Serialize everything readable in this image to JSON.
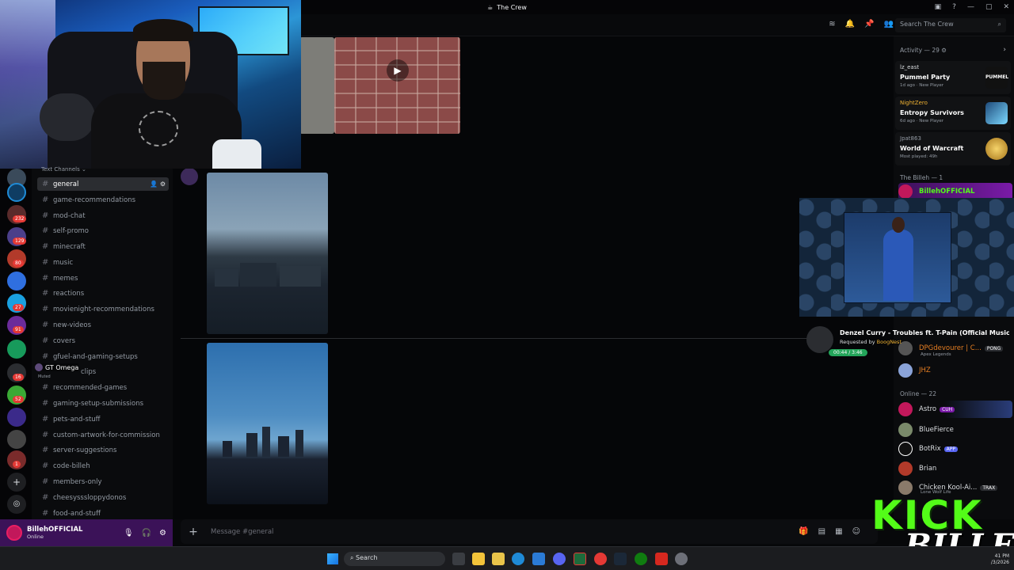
{
  "window": {
    "title": "The Crew",
    "search_placeholder": "Search The Crew"
  },
  "channels": {
    "header": "Text Channels",
    "items": [
      {
        "label": "general",
        "active": true
      },
      {
        "label": "game-recommendations"
      },
      {
        "label": "mod-chat"
      },
      {
        "label": "self-promo"
      },
      {
        "label": "minecraft"
      },
      {
        "label": "music"
      },
      {
        "label": "memes"
      },
      {
        "label": "reactions"
      },
      {
        "label": "movienight-recommendations"
      },
      {
        "label": "new-videos"
      },
      {
        "label": "covers"
      },
      {
        "label": "gfuel-and-gaming-setups"
      },
      {
        "label": "clips"
      },
      {
        "label": "recommended-games"
      },
      {
        "label": "gaming-setup-submissions"
      },
      {
        "label": "pets-and-stuff"
      },
      {
        "label": "custom-artwork-for-commission"
      },
      {
        "label": "server-suggestions"
      },
      {
        "label": "code-billeh"
      },
      {
        "label": "members-only"
      },
      {
        "label": "cheesysssloppydonos"
      },
      {
        "label": "food-and-stuff"
      }
    ]
  },
  "server_badges": [
    "232",
    "129",
    "80",
    "27",
    "91",
    "16",
    "52",
    "1"
  ],
  "overlay_user": {
    "name": "GT Omega",
    "sub": "Muted"
  },
  "user_panel": {
    "name": "BillehOFFICIAL",
    "status": "Online"
  },
  "composer": {
    "placeholder": "Message #general"
  },
  "members": {
    "activity_header": "Activity — 29",
    "activities": [
      {
        "user": "lz_east",
        "game": "Pummel Party",
        "meta": "1d ago · New Player",
        "art_label": "PUMMEL PARTY"
      },
      {
        "user": "NightZero",
        "game": "Entropy Survivors",
        "meta": "6d ago · New Player"
      },
      {
        "user": "Jpat863",
        "game": "World of Warcraft",
        "meta": "Most played: 49h"
      }
    ],
    "billeh_header": "The Billeh — 1",
    "billeh_member": "BillehOFFICIAL",
    "partial_members": [
      {
        "name": "DPGdevourer | C...",
        "sub": "Apex Legends",
        "tag": "PONG"
      },
      {
        "name": "JHZ"
      }
    ],
    "online_header": "Online — 22",
    "online": [
      {
        "name": "Astro",
        "tag": "CUH"
      },
      {
        "name": "BlueFierce"
      },
      {
        "name": "BotRix",
        "tag": "APP"
      },
      {
        "name": "Brian"
      },
      {
        "name": "Chicken Kool-Ai...",
        "tag": "TRAX",
        "sub": "Lone Wolf Life"
      }
    ]
  },
  "now_playing": {
    "title": "Denzel Curry - Troubles ft. T-Pain (Official Music ...",
    "requested_prefix": "Requested by",
    "requester": "BoogNest",
    "time": "00:44 / 3:46"
  },
  "kick_overlay": {
    "line1": "KICK",
    "line2": "BILLEH"
  },
  "taskbar": {
    "search_label": "Search",
    "time": "41 PM",
    "date": "/3/2026"
  }
}
